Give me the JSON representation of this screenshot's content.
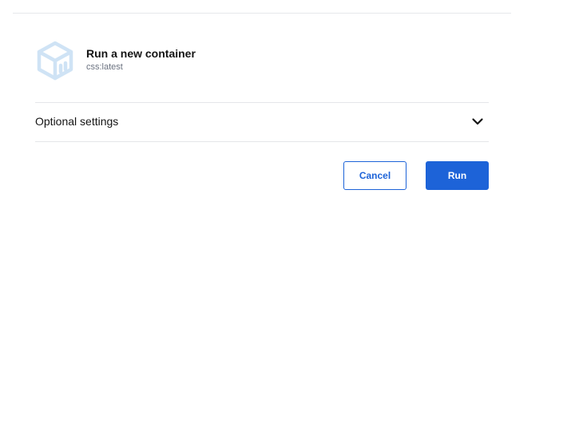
{
  "dialog": {
    "title": "Run a new container",
    "image_name": "css:latest",
    "image_icon": "container-cube-icon",
    "optional_settings_label": "Optional settings",
    "optional_settings_icon": "chevron-down-icon",
    "cancel_label": "Cancel",
    "run_label": "Run"
  },
  "colors": {
    "accent": "#1d63d8",
    "icon_tint": "#cfe3f5",
    "divider": "#e4e6e9"
  }
}
